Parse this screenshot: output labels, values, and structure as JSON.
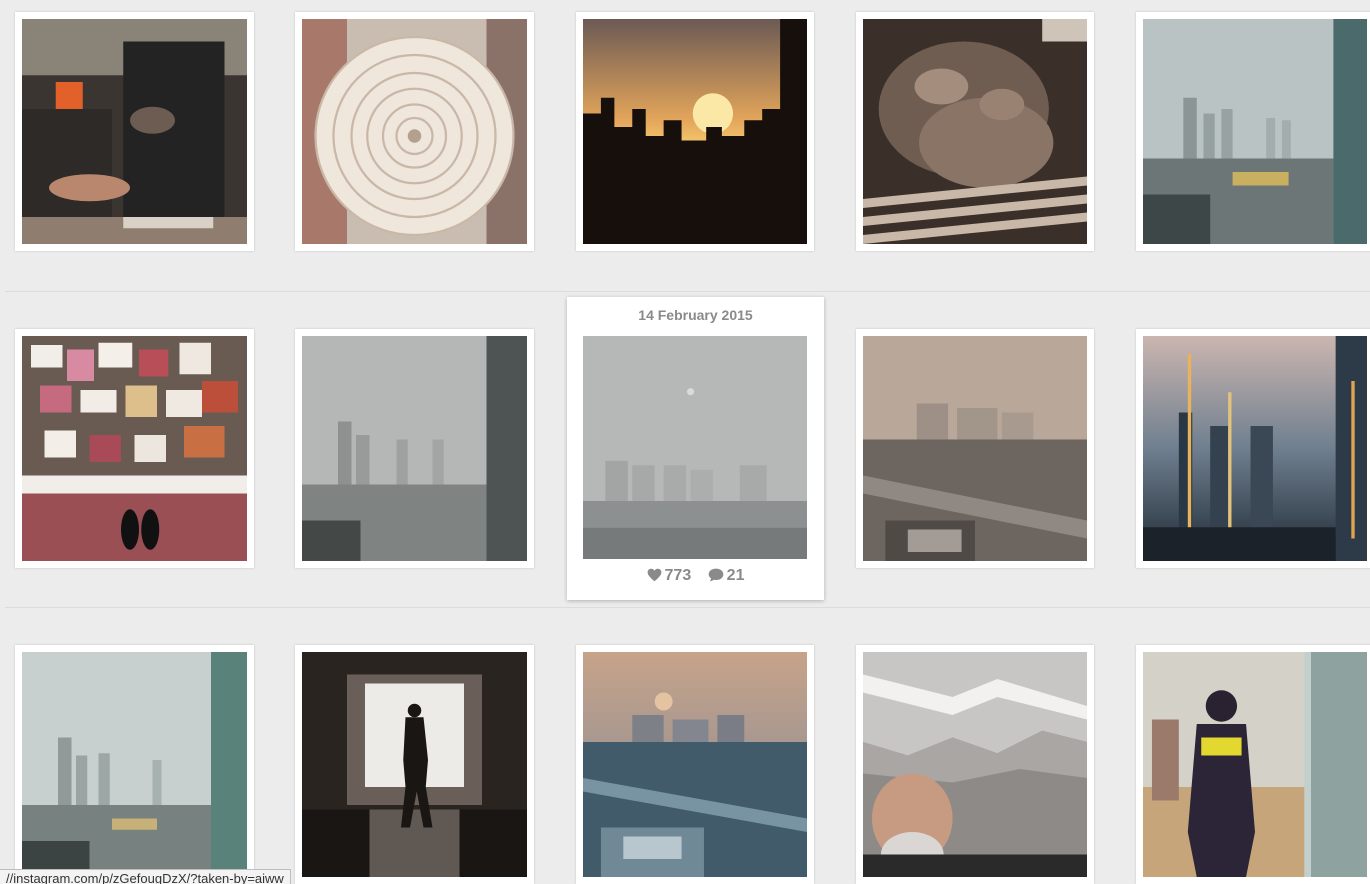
{
  "hovered_post": {
    "date": "14 February 2015",
    "likes": "773",
    "comments": "21"
  },
  "status_bar": {
    "url": "//instagram.com/p/zGefougDzX/?taken-by=aiww"
  },
  "photos": [
    {
      "row": 1,
      "col": 1,
      "subject": "hands-with-objects"
    },
    {
      "row": 1,
      "col": 2,
      "subject": "paper-spiral"
    },
    {
      "row": 1,
      "col": 3,
      "subject": "sunset-skyline"
    },
    {
      "row": 1,
      "col": 4,
      "subject": "carved-relief"
    },
    {
      "row": 1,
      "col": 5,
      "subject": "hazy-city-view"
    },
    {
      "row": 2,
      "col": 1,
      "subject": "box-of-postcards"
    },
    {
      "row": 2,
      "col": 2,
      "subject": "smoggy-city-view"
    },
    {
      "row": 2,
      "col": 3,
      "subject": "smog-skyline"
    },
    {
      "row": 2,
      "col": 4,
      "subject": "smoggy-rail-yard"
    },
    {
      "row": 2,
      "col": 5,
      "subject": "window-reflection-dusk"
    },
    {
      "row": 3,
      "col": 1,
      "subject": "hazy-towers"
    },
    {
      "row": 3,
      "col": 2,
      "subject": "silhouette-in-window"
    },
    {
      "row": 3,
      "col": 3,
      "subject": "hazy-sunrise-rail-yard"
    },
    {
      "row": 3,
      "col": 4,
      "subject": "man-under-foil"
    },
    {
      "row": 3,
      "col": 5,
      "subject": "security-guard"
    }
  ],
  "colors": {
    "page_background": "#ececec",
    "card_background": "#ffffff",
    "stats_text": "#8a8a8a"
  },
  "icons": {
    "likes": "heart-icon",
    "comments": "speech-bubble-icon"
  }
}
